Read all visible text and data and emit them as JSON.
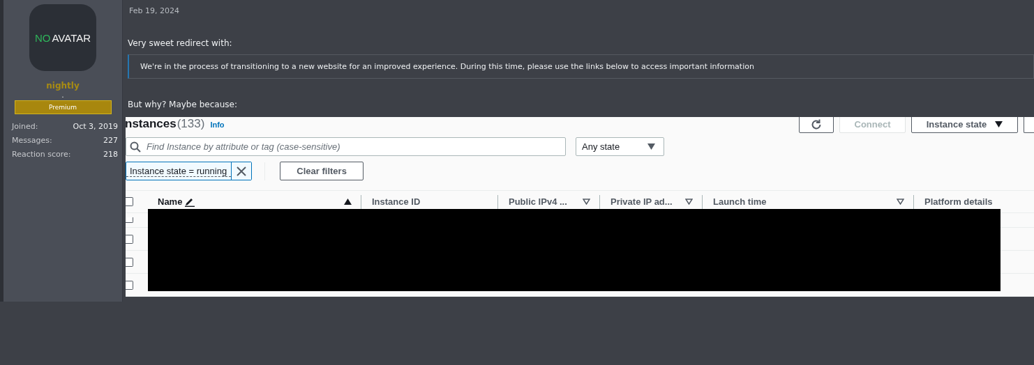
{
  "author": {
    "avatar": {
      "word_1": "NO",
      "word_2": "AVATAR"
    },
    "username": "nightly",
    "title": ".",
    "badge": "Premium",
    "stats": [
      {
        "label": "Joined:",
        "value": "Oct 3, 2019"
      },
      {
        "label": "Messages:",
        "value": "227"
      },
      {
        "label": "Reaction score:",
        "value": "218"
      }
    ]
  },
  "post": {
    "date": "Feb 19, 2024",
    "paragraph_1": "Very sweet redirect with:",
    "quote": "We're in the process of transitioning to a new website for an improved experience. During this time, please use the links below to access important information",
    "paragraph_2": "But why? Maybe because:",
    "screenshot": {
      "title": "nstances",
      "count": "(133)",
      "info": "Info",
      "buttons": [
        {
          "kind": "refresh",
          "disabled": false
        },
        {
          "kind": "text",
          "label": "Connect",
          "disabled": true
        },
        {
          "kind": "dropdown",
          "label": "Instance state",
          "disabled": false
        },
        {
          "kind": "partial",
          "disabled": false
        }
      ],
      "search": {
        "placeholder": "Find Instance by attribute or tag (case-sensitive)"
      },
      "state_filter": {
        "value": "Any state"
      },
      "filter_token": "Instance state = running",
      "clear_button": "Clear filters",
      "select_all": {
        "checked": false
      },
      "columns": [
        {
          "label": "Name",
          "kind": "sorted"
        },
        {
          "label": "Instance ID",
          "kind": "plain"
        },
        {
          "label": "Public IPv4 ...",
          "kind": "filter"
        },
        {
          "label": "Private IP ad...",
          "kind": "filter"
        },
        {
          "label": "Launch time",
          "kind": "filter"
        },
        {
          "label": "Platform details",
          "kind": "plain"
        }
      ],
      "rows": [
        {
          "checked": false
        },
        {
          "checked": false
        },
        {
          "checked": false
        },
        {
          "checked": false
        }
      ]
    }
  }
}
